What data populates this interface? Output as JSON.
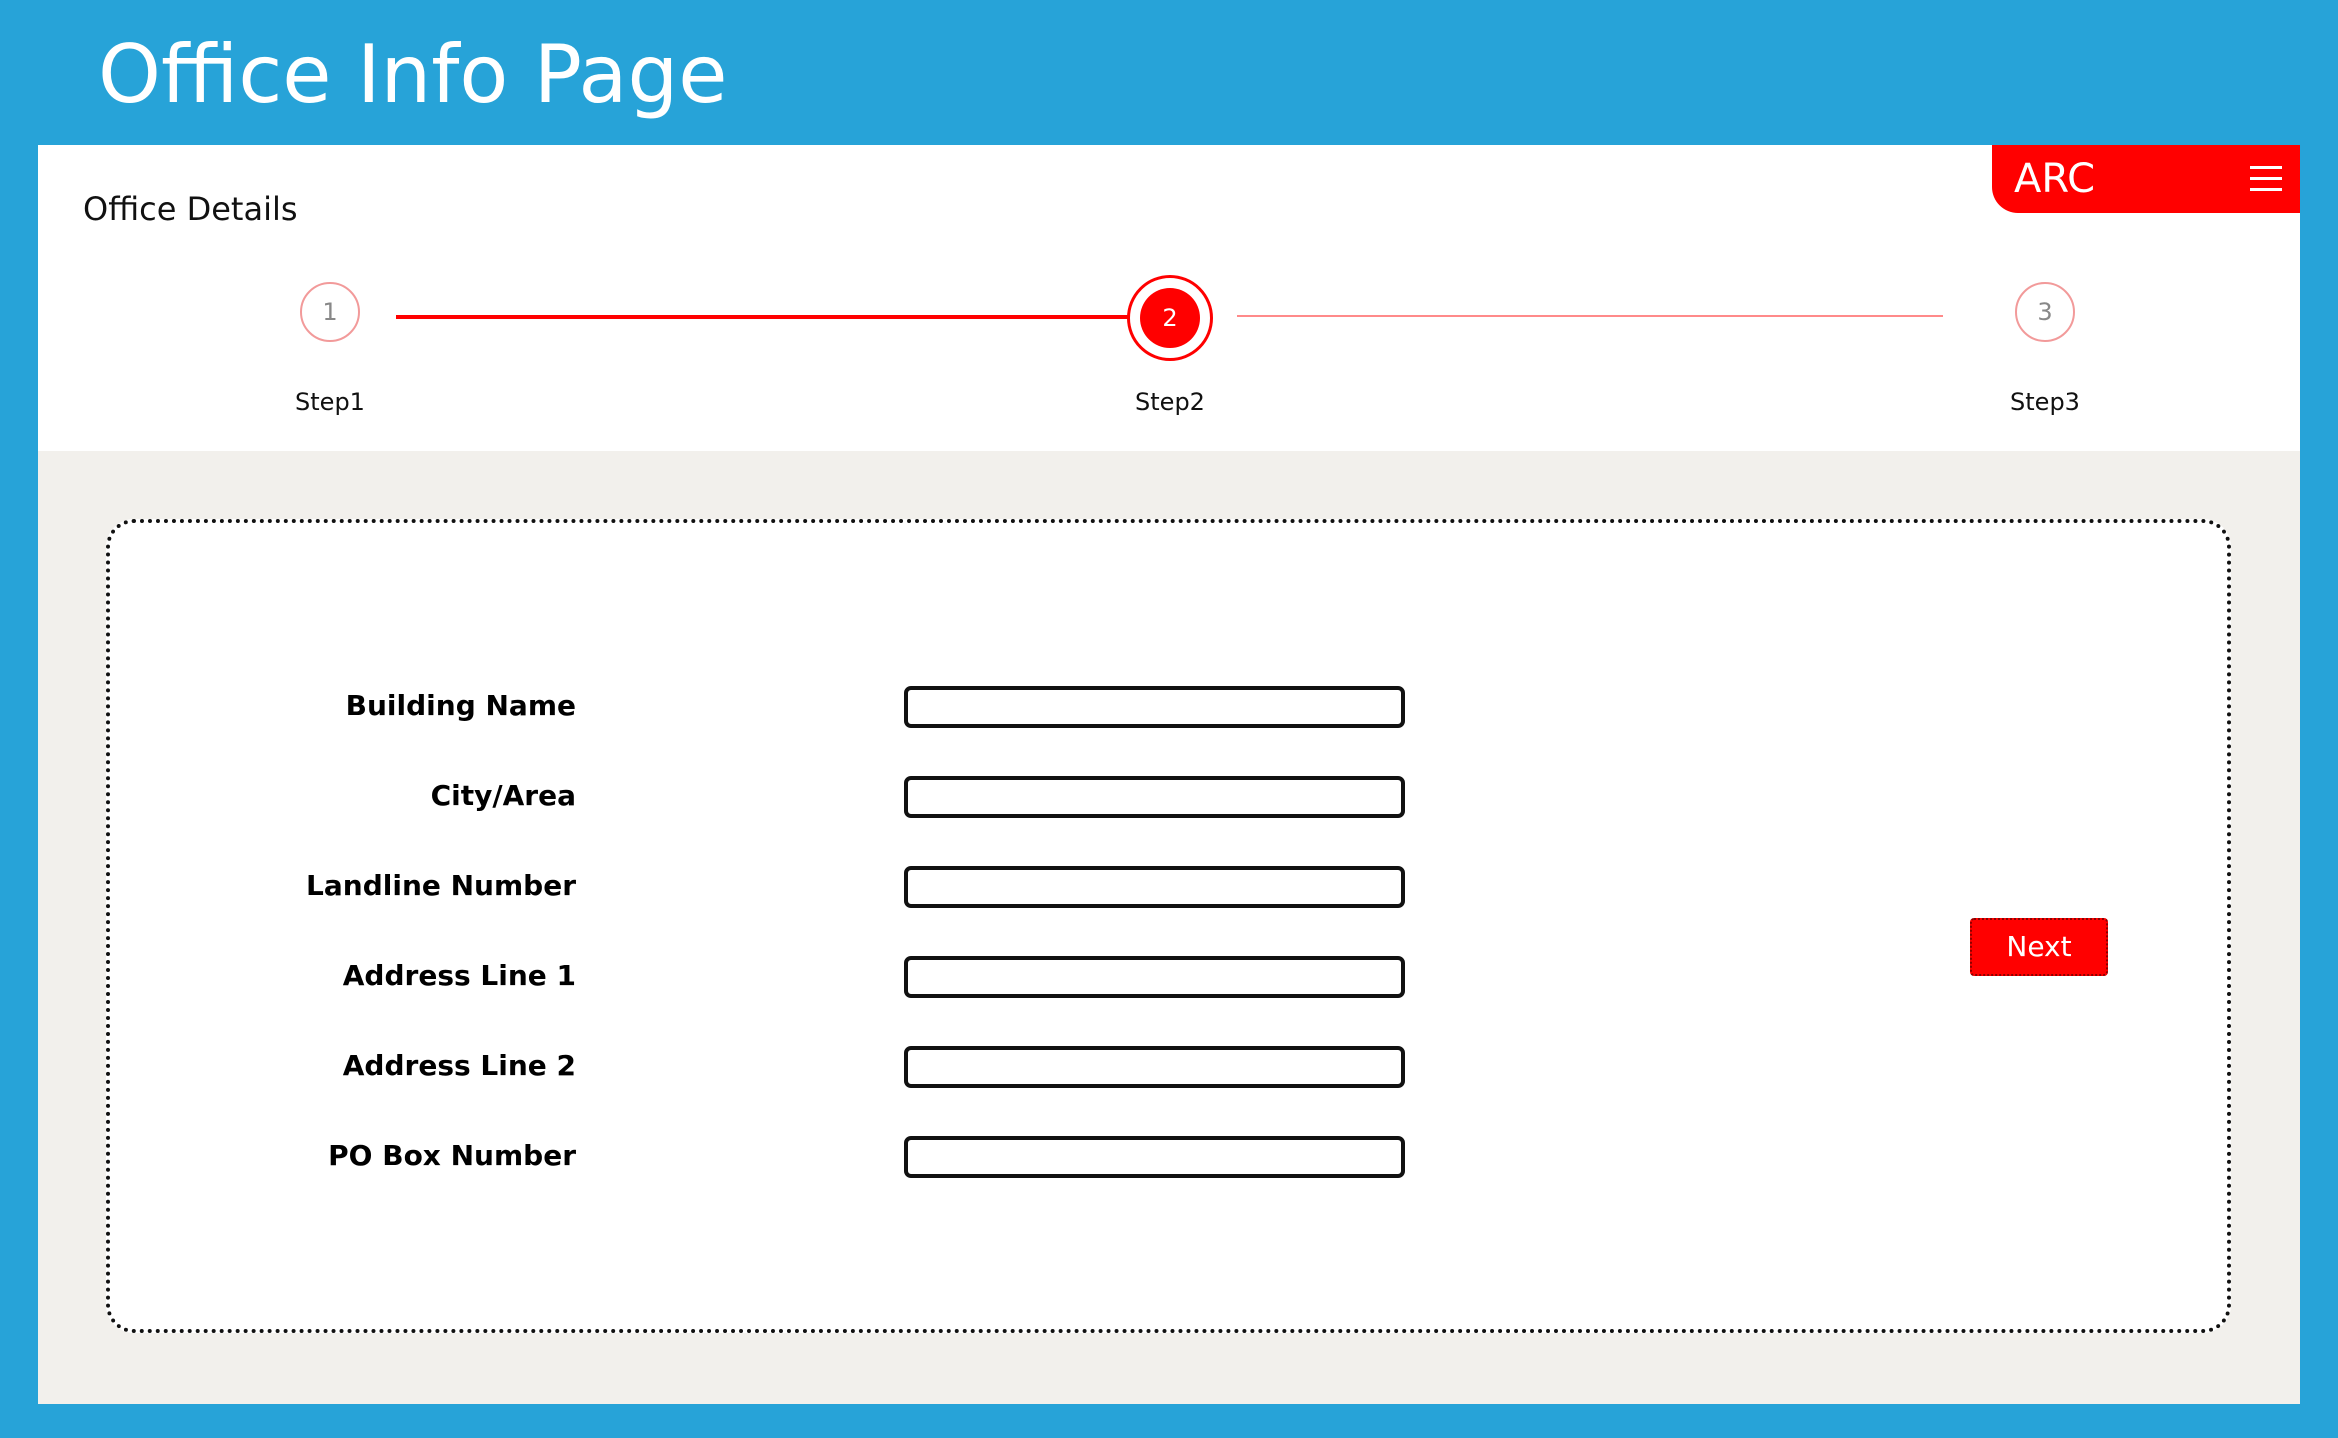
{
  "header": {
    "title": "Office Info Page"
  },
  "brand": {
    "name": "ARC",
    "menu_icon": "hamburger-menu-icon",
    "color": "#ff0000"
  },
  "section": {
    "title": "Office Details"
  },
  "stepper": {
    "current_step": 2,
    "steps": [
      {
        "number": "1",
        "label": "Step1",
        "state": "completed"
      },
      {
        "number": "2",
        "label": "Step2",
        "state": "active"
      },
      {
        "number": "3",
        "label": "Step3",
        "state": "pending"
      }
    ]
  },
  "form": {
    "fields": [
      {
        "label": "Building Name",
        "value": ""
      },
      {
        "label": "City/Area",
        "value": ""
      },
      {
        "label": "Landline Number",
        "value": ""
      },
      {
        "label": "Address Line 1",
        "value": ""
      },
      {
        "label": "Address Line 2",
        "value": ""
      },
      {
        "label": "PO Box Number",
        "value": ""
      }
    ],
    "next_label": "Next"
  },
  "colors": {
    "page_background": "#27a3d8",
    "accent": "#ff0000",
    "panel_background": "#f2f0ec"
  }
}
